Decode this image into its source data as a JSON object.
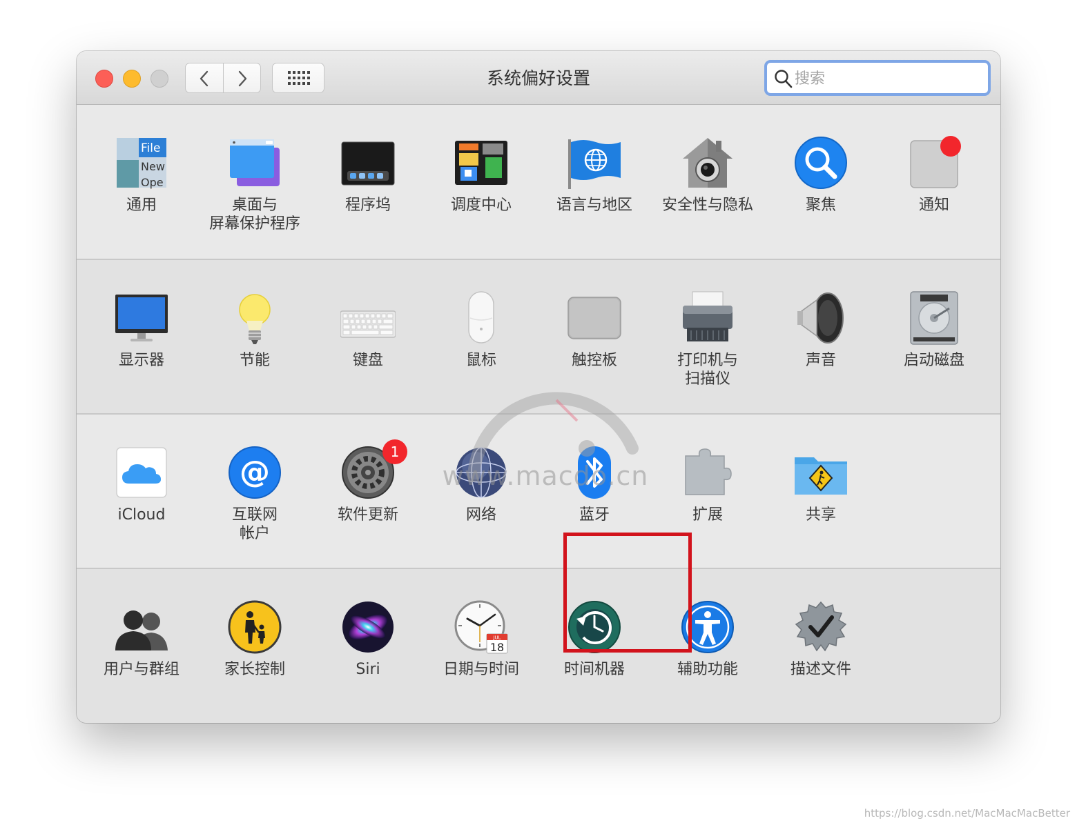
{
  "window": {
    "title": "系统偏好设置",
    "search_placeholder": "搜索"
  },
  "panes": {
    "row1": [
      {
        "label": "通用",
        "icon": "general-icon"
      },
      {
        "label": "桌面与\n屏幕保护程序",
        "icon": "desktop-screensaver-icon"
      },
      {
        "label": "程序坞",
        "icon": "dock-icon"
      },
      {
        "label": "调度中心",
        "icon": "mission-control-icon"
      },
      {
        "label": "语言与地区",
        "icon": "language-region-icon"
      },
      {
        "label": "安全性与隐私",
        "icon": "security-privacy-icon"
      },
      {
        "label": "聚焦",
        "icon": "spotlight-icon"
      },
      {
        "label": "通知",
        "icon": "notifications-icon"
      }
    ],
    "row2": [
      {
        "label": "显示器",
        "icon": "displays-icon"
      },
      {
        "label": "节能",
        "icon": "energy-saver-icon"
      },
      {
        "label": "键盘",
        "icon": "keyboard-icon"
      },
      {
        "label": "鼠标",
        "icon": "mouse-icon"
      },
      {
        "label": "触控板",
        "icon": "trackpad-icon"
      },
      {
        "label": "打印机与\n扫描仪",
        "icon": "printers-scanners-icon"
      },
      {
        "label": "声音",
        "icon": "sound-icon"
      },
      {
        "label": "启动磁盘",
        "icon": "startup-disk-icon"
      }
    ],
    "row3": [
      {
        "label": "iCloud",
        "icon": "icloud-icon"
      },
      {
        "label": "互联网\n帐户",
        "icon": "internet-accounts-icon"
      },
      {
        "label": "软件更新",
        "icon": "software-update-icon",
        "badge": "1"
      },
      {
        "label": "网络",
        "icon": "network-icon"
      },
      {
        "label": "蓝牙",
        "icon": "bluetooth-icon"
      },
      {
        "label": "扩展",
        "icon": "extensions-icon"
      },
      {
        "label": "共享",
        "icon": "sharing-icon"
      }
    ],
    "row4": [
      {
        "label": "用户与群组",
        "icon": "users-groups-icon"
      },
      {
        "label": "家长控制",
        "icon": "parental-controls-icon"
      },
      {
        "label": "Siri",
        "icon": "siri-icon"
      },
      {
        "label": "日期与时间",
        "icon": "date-time-icon",
        "calendar_month": "JUL",
        "calendar_day": "18"
      },
      {
        "label": "时间机器",
        "icon": "time-machine-icon"
      },
      {
        "label": "辅助功能",
        "icon": "accessibility-icon"
      },
      {
        "label": "描述文件",
        "icon": "profiles-icon"
      }
    ]
  },
  "general_icon_text": [
    "File",
    "New",
    "Ope"
  ],
  "watermark": "www.macdo.cn",
  "credit": "https://blog.csdn.net/MacMacMacBetter",
  "colors": {
    "highlight_border": "#d2131c",
    "search_focus": "#7ea6e6",
    "badge": "#f2262c"
  }
}
